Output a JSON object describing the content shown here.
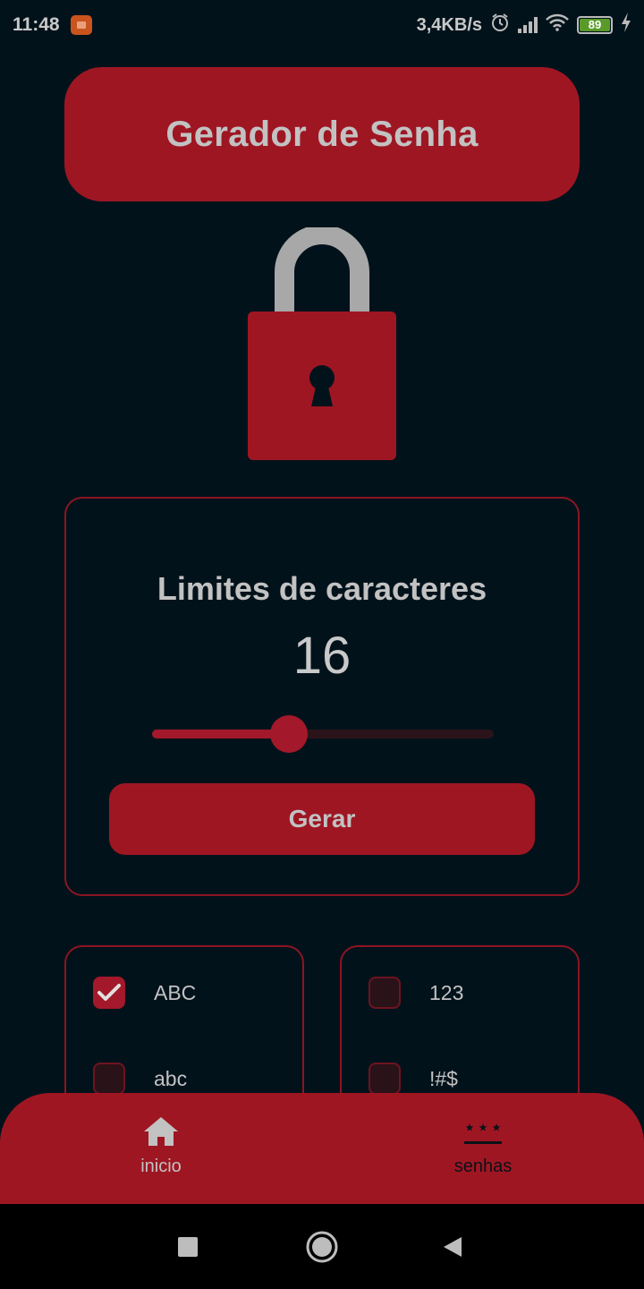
{
  "status_bar": {
    "time": "11:48",
    "network_speed": "3,4KB/s",
    "battery_level": "89",
    "icons": [
      "app-notification-icon",
      "alarm-icon",
      "signal-icon",
      "wifi-icon",
      "battery-icon",
      "charging-icon"
    ]
  },
  "header": {
    "title": "Gerador de Senha"
  },
  "generator": {
    "limits_label": "Limites de caracteres",
    "limit_value": "16",
    "slider_fraction": 0.4,
    "generate_label": "Gerar"
  },
  "options": {
    "left": [
      {
        "label": "ABC",
        "checked": true
      },
      {
        "label": "abc",
        "checked": false
      }
    ],
    "right": [
      {
        "label": "123",
        "checked": false
      },
      {
        "label": "!#$",
        "checked": false
      }
    ]
  },
  "bottom_nav": {
    "items": [
      {
        "label": "inicio",
        "icon": "home-icon",
        "active": false
      },
      {
        "label": "senhas",
        "icon": "password-icon",
        "active": true
      }
    ]
  },
  "colors": {
    "background": "#02121b",
    "accent": "#9f1623",
    "text": "#c2c2c2",
    "active_nav_text": "#0a1218"
  }
}
